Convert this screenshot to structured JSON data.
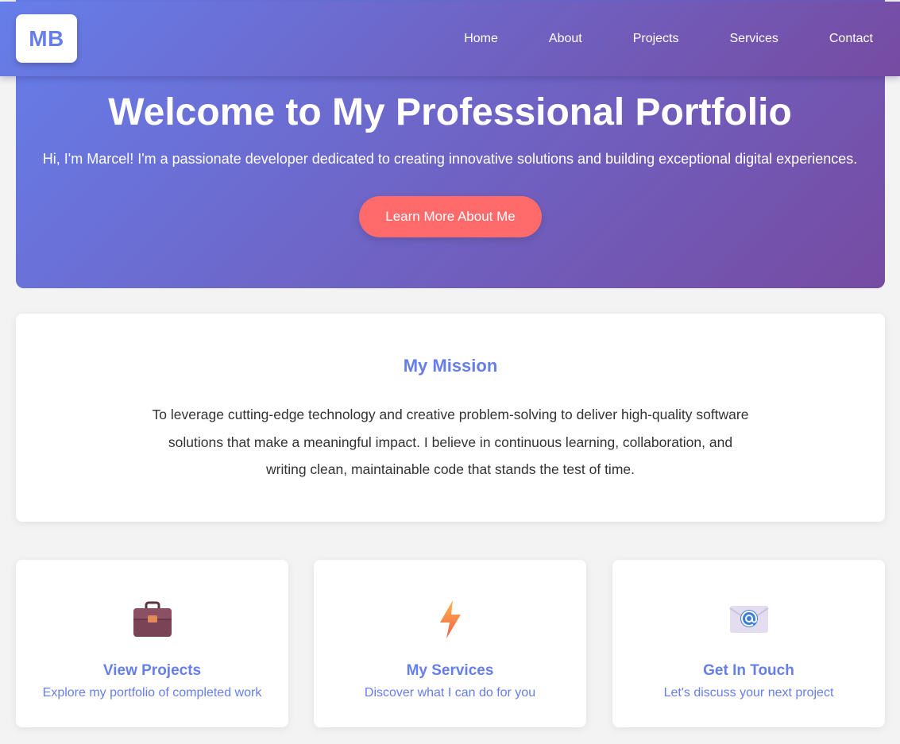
{
  "nav": {
    "logo": "MB",
    "links": [
      {
        "label": "Home"
      },
      {
        "label": "About"
      },
      {
        "label": "Projects"
      },
      {
        "label": "Services"
      },
      {
        "label": "Contact"
      }
    ]
  },
  "hero": {
    "title": "Welcome to My Professional Portfolio",
    "subtitle": "Hi, I'm Marcel! I'm a passionate developer dedicated to creating innovative solutions and building exceptional digital experiences.",
    "button_label": "Learn More About Me"
  },
  "mission": {
    "title": "My Mission",
    "text": "To leverage cutting-edge technology and creative problem-solving to deliver high-quality software solutions that make a meaningful impact. I believe in continuous learning, collaboration, and writing clean, maintainable code that stands the test of time."
  },
  "cards": [
    {
      "icon": "briefcase-icon",
      "title": "View Projects",
      "description": "Explore my portfolio of completed work"
    },
    {
      "icon": "lightning-icon",
      "title": "My Services",
      "description": "Discover what I can do for you"
    },
    {
      "icon": "email-icon",
      "title": "Get In Touch",
      "description": "Let's discuss your next project"
    }
  ],
  "colors": {
    "gradient_start": "#667eea",
    "gradient_end": "#764ba2",
    "accent_button": "#ff6b6b",
    "heading_accent": "#667eea",
    "body_text": "#333333",
    "page_background": "#f3f3f4"
  }
}
